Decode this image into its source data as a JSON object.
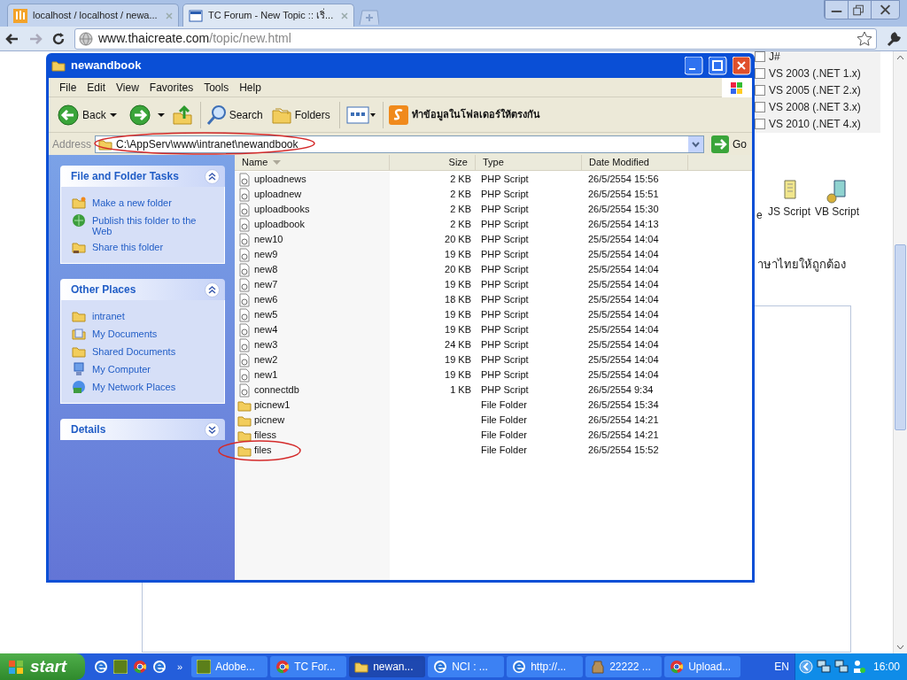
{
  "browser": {
    "tabs": [
      {
        "title": "localhost / localhost / newa...",
        "kind": "pma",
        "selected": false
      },
      {
        "title": "TC Forum - New Topic :: เริ่...",
        "kind": "forum",
        "selected": true
      }
    ],
    "url_host": "www.thaicreate.com",
    "url_path": "/topic/new.html"
  },
  "page": {
    "checkboxes": [
      {
        "label": "J#",
        "checked": false
      },
      {
        "label": "VS 2003 (.NET 1.x)",
        "checked": false
      },
      {
        "label": "VS 2005 (.NET 2.x)",
        "checked": false
      },
      {
        "label": "VS 2008 (.NET 3.x)",
        "checked": false
      },
      {
        "label": "VS 2010 (.NET 4.x)",
        "checked": false
      }
    ],
    "cut_letter": "e",
    "script_icons": [
      {
        "label": "JS Script",
        "kind": "js"
      },
      {
        "label": "VB Script",
        "kind": "vb"
      }
    ],
    "thai_text": "าษาไทยให้ถูกต้อง"
  },
  "explorer": {
    "title": "newandbook",
    "menu": [
      "File",
      "Edit",
      "View",
      "Favorites",
      "Tools",
      "Help"
    ],
    "toolbar": {
      "back": "Back",
      "search": "Search",
      "folders": "Folders",
      "sync": "ทำข้อมูลในโฟลเดอร์ให้ตรงกัน"
    },
    "address_label": "Address",
    "address": "C:\\AppServ\\www\\intranet\\newandbook",
    "address_highlighted": true,
    "go": "Go",
    "panels": [
      {
        "title": "File and Folder Tasks",
        "expanded": true,
        "items": [
          {
            "label": "Make a new folder",
            "kind": "newfolder"
          },
          {
            "label": "Publish this folder to the Web",
            "kind": "globe"
          },
          {
            "label": "Share this folder",
            "kind": "share"
          }
        ]
      },
      {
        "title": "Other Places",
        "expanded": true,
        "items": [
          {
            "label": "intranet",
            "kind": "folder"
          },
          {
            "label": "My Documents",
            "kind": "documents"
          },
          {
            "label": "Shared Documents",
            "kind": "folder"
          },
          {
            "label": "My Computer",
            "kind": "computer"
          },
          {
            "label": "My Network Places",
            "kind": "network"
          }
        ]
      },
      {
        "title": "Details",
        "expanded": false
      }
    ],
    "columns": [
      {
        "label": "Name",
        "sorted": true
      },
      {
        "label": "Size",
        "sorted": false
      },
      {
        "label": "Type",
        "sorted": false
      },
      {
        "label": "Date Modified",
        "sorted": false
      }
    ],
    "files": [
      {
        "name": "uploadnews",
        "size": "2 KB",
        "type": "PHP Script",
        "date": "26/5/2554 15:56",
        "kind": "script",
        "highlighted": false
      },
      {
        "name": "uploadnew",
        "size": "2 KB",
        "type": "PHP Script",
        "date": "26/5/2554 15:51",
        "kind": "script",
        "highlighted": false
      },
      {
        "name": "uploadbooks",
        "size": "2 KB",
        "type": "PHP Script",
        "date": "26/5/2554 15:30",
        "kind": "script",
        "highlighted": false
      },
      {
        "name": "uploadbook",
        "size": "2 KB",
        "type": "PHP Script",
        "date": "26/5/2554 14:13",
        "kind": "script",
        "highlighted": false
      },
      {
        "name": "new10",
        "size": "20 KB",
        "type": "PHP Script",
        "date": "25/5/2554 14:04",
        "kind": "script",
        "highlighted": false
      },
      {
        "name": "new9",
        "size": "19 KB",
        "type": "PHP Script",
        "date": "25/5/2554 14:04",
        "kind": "script",
        "highlighted": false
      },
      {
        "name": "new8",
        "size": "20 KB",
        "type": "PHP Script",
        "date": "25/5/2554 14:04",
        "kind": "script",
        "highlighted": false
      },
      {
        "name": "new7",
        "size": "19 KB",
        "type": "PHP Script",
        "date": "25/5/2554 14:04",
        "kind": "script",
        "highlighted": false
      },
      {
        "name": "new6",
        "size": "18 KB",
        "type": "PHP Script",
        "date": "25/5/2554 14:04",
        "kind": "script",
        "highlighted": false
      },
      {
        "name": "new5",
        "size": "19 KB",
        "type": "PHP Script",
        "date": "25/5/2554 14:04",
        "kind": "script",
        "highlighted": false
      },
      {
        "name": "new4",
        "size": "19 KB",
        "type": "PHP Script",
        "date": "25/5/2554 14:04",
        "kind": "script",
        "highlighted": false
      },
      {
        "name": "new3",
        "size": "24 KB",
        "type": "PHP Script",
        "date": "25/5/2554 14:04",
        "kind": "script",
        "highlighted": false
      },
      {
        "name": "new2",
        "size": "19 KB",
        "type": "PHP Script",
        "date": "25/5/2554 14:04",
        "kind": "script",
        "highlighted": false
      },
      {
        "name": "new1",
        "size": "19 KB",
        "type": "PHP Script",
        "date": "25/5/2554 14:04",
        "kind": "script",
        "highlighted": false
      },
      {
        "name": "connectdb",
        "size": "1 KB",
        "type": "PHP Script",
        "date": "26/5/2554 9:34",
        "kind": "script",
        "highlighted": false
      },
      {
        "name": "picnew1",
        "type": "File Folder",
        "date": "26/5/2554 15:34",
        "kind": "folder",
        "highlighted": false
      },
      {
        "name": "picnew",
        "type": "File Folder",
        "date": "26/5/2554 14:21",
        "kind": "folder",
        "highlighted": false
      },
      {
        "name": "filess",
        "type": "File Folder",
        "date": "26/5/2554 14:21",
        "kind": "folder",
        "highlighted": false
      },
      {
        "name": "files",
        "type": "File Folder",
        "date": "26/5/2554 15:52",
        "kind": "folder",
        "highlighted": true
      }
    ]
  },
  "taskbar": {
    "start": "start",
    "quick_launch": [
      {
        "kind": "ie"
      },
      {
        "kind": "dw"
      },
      {
        "kind": "chrome"
      },
      {
        "kind": "ie"
      }
    ],
    "more": "»",
    "tasks": [
      {
        "label": "Adobe...",
        "kind": "dw",
        "selected": false
      },
      {
        "label": "TC For...",
        "kind": "chrome",
        "selected": false
      },
      {
        "label": "newan...",
        "kind": "folder",
        "selected": true
      },
      {
        "label": "NCI : ...",
        "kind": "ie",
        "selected": false
      },
      {
        "label": "http://...",
        "kind": "ie",
        "selected": false
      },
      {
        "label": "22222 ...",
        "kind": "app",
        "selected": false
      },
      {
        "label": "Upload...",
        "kind": "chrome",
        "selected": false
      }
    ],
    "language": "EN",
    "clock": "16:00"
  }
}
